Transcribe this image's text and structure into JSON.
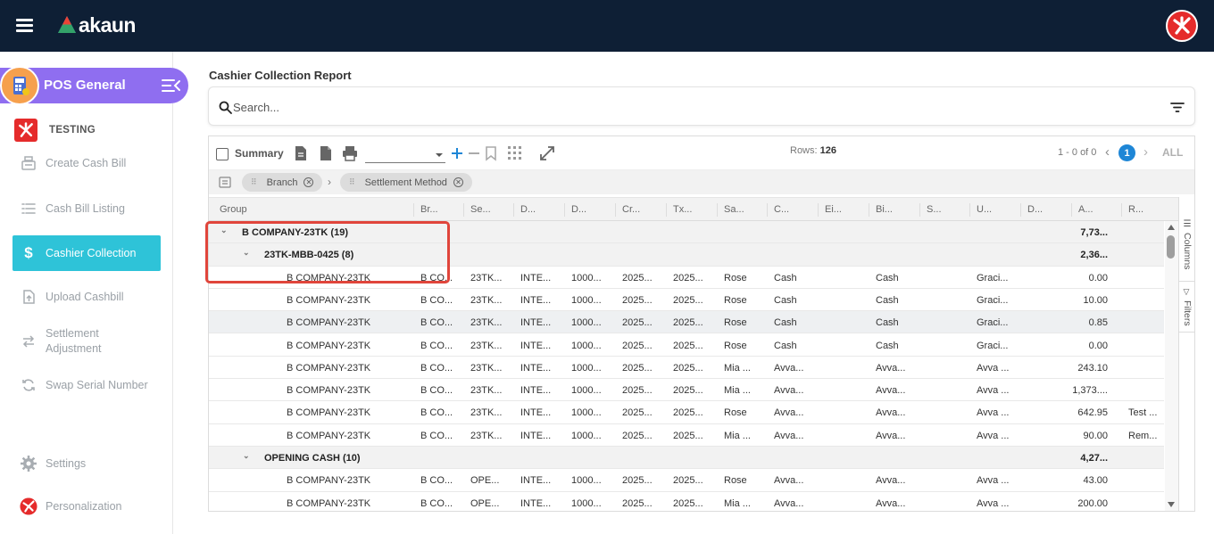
{
  "brand": {
    "name": "akaun",
    "accent": "#0e1f35"
  },
  "app": {
    "title": "POS General"
  },
  "company": {
    "name": "TESTING"
  },
  "sidebar": {
    "items": [
      {
        "label": "Create Cash Bill",
        "icon": "cash-register-icon"
      },
      {
        "label": "Cash Bill Listing",
        "icon": "list-icon"
      },
      {
        "label": "Cashier Collection",
        "icon": "dollar-icon",
        "active": true
      },
      {
        "label": "Upload Cashbill",
        "icon": "upload-icon"
      },
      {
        "label": "Settlement Adjustment",
        "icon": "swap-arrows-icon"
      },
      {
        "label": "Swap Serial Number",
        "icon": "refresh-icon"
      },
      {
        "label": "Settings",
        "icon": "gear-icon"
      },
      {
        "label": "Personalization",
        "icon": "user-logo-icon"
      }
    ]
  },
  "report": {
    "title": "Cashier Collection Report"
  },
  "search": {
    "placeholder": "Search..."
  },
  "toolbar": {
    "summary_label": "Summary",
    "rows_label": "Rows: ",
    "rows_value": "126",
    "pager_text": "1 - 0 of 0",
    "current_page": "1",
    "all_label": "ALL",
    "prev": "‹",
    "next": "›"
  },
  "group_by": {
    "chips": [
      "Branch",
      "Settlement Method"
    ],
    "separator": "›"
  },
  "side_tabs": {
    "columns": "Columns",
    "filters": "Filters"
  },
  "grid": {
    "columns": [
      "Group",
      "Br...",
      "Se...",
      "D...",
      "D...",
      "Cr...",
      "Tx...",
      "Sa...",
      "C...",
      "Ei...",
      "Bi...",
      "S...",
      "U...",
      "D...",
      "A...",
      "R..."
    ],
    "rows": [
      {
        "type": "group",
        "level": 0,
        "label": "B COMPANY-23TK (19)",
        "amount": "7,73..."
      },
      {
        "type": "group",
        "level": 1,
        "label": "23TK-MBB-0425 (8)",
        "amount": "2,36..."
      },
      {
        "type": "data",
        "cells": [
          "B COMPANY-23TK",
          "B CO...",
          "23TK...",
          "INTE...",
          "1000...",
          "2025...",
          "2025...",
          "Rose",
          "Cash",
          "",
          "Cash",
          "",
          "Graci...",
          "",
          "0.00",
          ""
        ]
      },
      {
        "type": "data",
        "cells": [
          "B COMPANY-23TK",
          "B CO...",
          "23TK...",
          "INTE...",
          "1000...",
          "2025...",
          "2025...",
          "Rose",
          "Cash",
          "",
          "Cash",
          "",
          "Graci...",
          "",
          "10.00",
          ""
        ]
      },
      {
        "type": "data",
        "selected": true,
        "cells": [
          "B COMPANY-23TK",
          "B CO...",
          "23TK...",
          "INTE...",
          "1000...",
          "2025...",
          "2025...",
          "Rose",
          "Cash",
          "",
          "Cash",
          "",
          "Graci...",
          "",
          "0.85",
          ""
        ]
      },
      {
        "type": "data",
        "cells": [
          "B COMPANY-23TK",
          "B CO...",
          "23TK...",
          "INTE...",
          "1000...",
          "2025...",
          "2025...",
          "Rose",
          "Cash",
          "",
          "Cash",
          "",
          "Graci...",
          "",
          "0.00",
          ""
        ]
      },
      {
        "type": "data",
        "cells": [
          "B COMPANY-23TK",
          "B CO...",
          "23TK...",
          "INTE...",
          "1000...",
          "2025...",
          "2025...",
          "Mia ...",
          "Avva...",
          "",
          "Avva...",
          "",
          "Avva ...",
          "",
          "243.10",
          ""
        ]
      },
      {
        "type": "data",
        "cells": [
          "B COMPANY-23TK",
          "B CO...",
          "23TK...",
          "INTE...",
          "1000...",
          "2025...",
          "2025...",
          "Mia ...",
          "Avva...",
          "",
          "Avva...",
          "",
          "Avva ...",
          "",
          "1,373....",
          ""
        ]
      },
      {
        "type": "data",
        "cells": [
          "B COMPANY-23TK",
          "B CO...",
          "23TK...",
          "INTE...",
          "1000...",
          "2025...",
          "2025...",
          "Rose",
          "Avva...",
          "",
          "Avva...",
          "",
          "Avva ...",
          "",
          "642.95",
          "Test ..."
        ]
      },
      {
        "type": "data",
        "cells": [
          "B COMPANY-23TK",
          "B CO...",
          "23TK...",
          "INTE...",
          "1000...",
          "2025...",
          "2025...",
          "Mia ...",
          "Avva...",
          "",
          "Avva...",
          "",
          "Avva ...",
          "",
          "90.00",
          "Rem..."
        ]
      },
      {
        "type": "group",
        "level": 1,
        "label": "OPENING CASH (10)",
        "amount": "4,27..."
      },
      {
        "type": "data",
        "cells": [
          "B COMPANY-23TK",
          "B CO...",
          "OPE...",
          "INTE...",
          "1000...",
          "2025...",
          "2025...",
          "Rose",
          "Avva...",
          "",
          "Avva...",
          "",
          "Avva ...",
          "",
          "43.00",
          ""
        ]
      },
      {
        "type": "data",
        "cells": [
          "B COMPANY-23TK",
          "B CO...",
          "OPE...",
          "INTE...",
          "1000...",
          "2025...",
          "2025...",
          "Mia ...",
          "Avva...",
          "",
          "Avva...",
          "",
          "Avva ...",
          "",
          "200.00",
          ""
        ]
      }
    ]
  }
}
